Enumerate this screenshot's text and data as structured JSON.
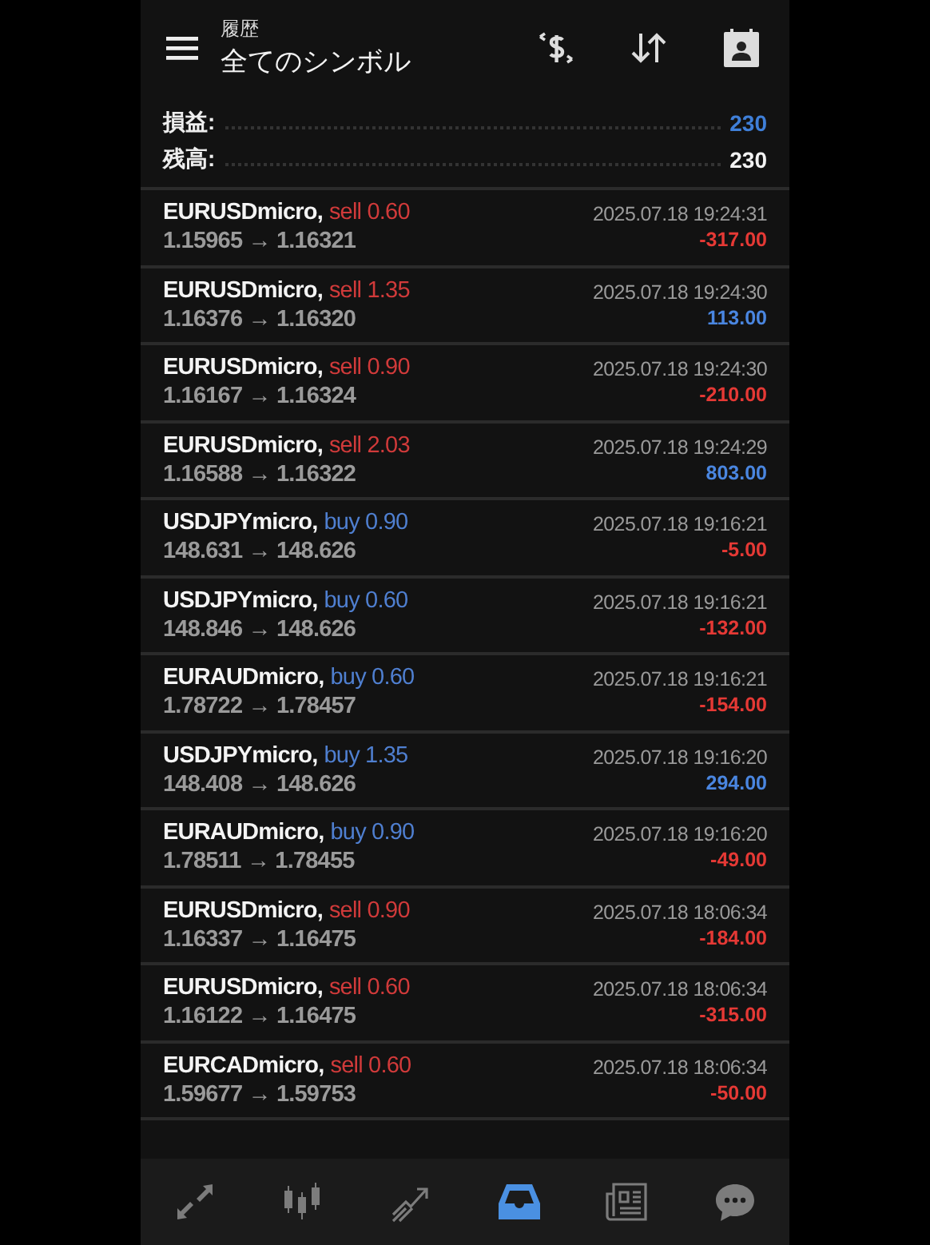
{
  "header": {
    "subtitle": "履歴",
    "title": "全てのシンボル"
  },
  "summary": [
    {
      "label": "損益:",
      "value": "230",
      "kind": "profit"
    },
    {
      "label": "残高:",
      "value": "230",
      "kind": "plain"
    }
  ],
  "trades": [
    {
      "symbol": "EURUSDmicro,",
      "side": {
        "text": "sell 0.60",
        "kind": "sell"
      },
      "prices": "1.15965 → 1.16321",
      "time": "2025.07.18 19:24:31",
      "profit": {
        "text": "-317.00",
        "kind": "loss"
      }
    },
    {
      "symbol": "EURUSDmicro,",
      "side": {
        "text": "sell 1.35",
        "kind": "sell"
      },
      "prices": "1.16376 → 1.16320",
      "time": "2025.07.18 19:24:30",
      "profit": {
        "text": "113.00",
        "kind": "gain"
      }
    },
    {
      "symbol": "EURUSDmicro,",
      "side": {
        "text": "sell 0.90",
        "kind": "sell"
      },
      "prices": "1.16167 → 1.16324",
      "time": "2025.07.18 19:24:30",
      "profit": {
        "text": "-210.00",
        "kind": "loss"
      }
    },
    {
      "symbol": "EURUSDmicro,",
      "side": {
        "text": "sell 2.03",
        "kind": "sell"
      },
      "prices": "1.16588 → 1.16322",
      "time": "2025.07.18 19:24:29",
      "profit": {
        "text": "803.00",
        "kind": "gain"
      }
    },
    {
      "symbol": "USDJPYmicro,",
      "side": {
        "text": "buy 0.90",
        "kind": "buy"
      },
      "prices": "148.631 → 148.626",
      "time": "2025.07.18 19:16:21",
      "profit": {
        "text": "-5.00",
        "kind": "loss"
      }
    },
    {
      "symbol": "USDJPYmicro,",
      "side": {
        "text": "buy 0.60",
        "kind": "buy"
      },
      "prices": "148.846 → 148.626",
      "time": "2025.07.18 19:16:21",
      "profit": {
        "text": "-132.00",
        "kind": "loss"
      }
    },
    {
      "symbol": "EURAUDmicro,",
      "side": {
        "text": "buy 0.60",
        "kind": "buy"
      },
      "prices": "1.78722 → 1.78457",
      "time": "2025.07.18 19:16:21",
      "profit": {
        "text": "-154.00",
        "kind": "loss"
      }
    },
    {
      "symbol": "USDJPYmicro,",
      "side": {
        "text": "buy 1.35",
        "kind": "buy"
      },
      "prices": "148.408 → 148.626",
      "time": "2025.07.18 19:16:20",
      "profit": {
        "text": "294.00",
        "kind": "gain"
      }
    },
    {
      "symbol": "EURAUDmicro,",
      "side": {
        "text": "buy 0.90",
        "kind": "buy"
      },
      "prices": "1.78511 → 1.78455",
      "time": "2025.07.18 19:16:20",
      "profit": {
        "text": "-49.00",
        "kind": "loss"
      }
    },
    {
      "symbol": "EURUSDmicro,",
      "side": {
        "text": "sell 0.90",
        "kind": "sell"
      },
      "prices": "1.16337 → 1.16475",
      "time": "2025.07.18 18:06:34",
      "profit": {
        "text": "-184.00",
        "kind": "loss"
      }
    },
    {
      "symbol": "EURUSDmicro,",
      "side": {
        "text": "sell 0.60",
        "kind": "sell"
      },
      "prices": "1.16122 → 1.16475",
      "time": "2025.07.18 18:06:34",
      "profit": {
        "text": "-315.00",
        "kind": "loss"
      }
    },
    {
      "symbol": "EURCADmicro,",
      "side": {
        "text": "sell 0.60",
        "kind": "sell"
      },
      "prices": "1.59677 → 1.59753",
      "time": "2025.07.18 18:06:34",
      "profit": {
        "text": "-50.00",
        "kind": "loss"
      }
    }
  ],
  "nav": [
    {
      "kind": "quotes",
      "selected": false
    },
    {
      "kind": "chart",
      "selected": false
    },
    {
      "kind": "trade",
      "selected": false
    },
    {
      "kind": "history",
      "selected": true
    },
    {
      "kind": "news",
      "selected": false
    },
    {
      "kind": "chat",
      "selected": false
    }
  ]
}
